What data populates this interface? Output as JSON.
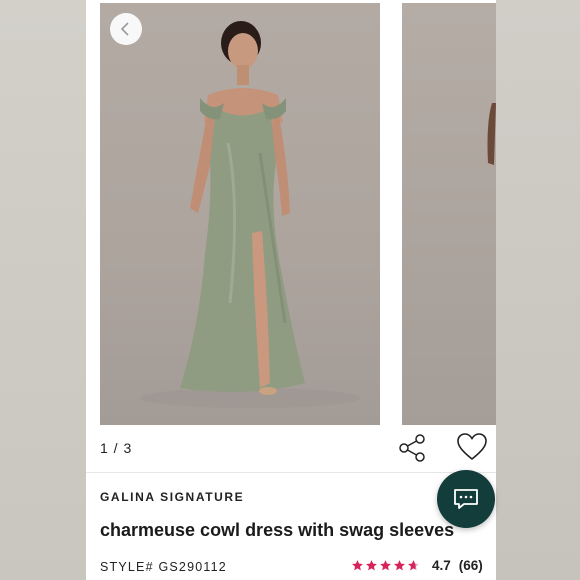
{
  "carousel": {
    "counter": "1 / 3",
    "back_icon": "chevron-left-icon",
    "share_icon": "share-icon",
    "favorite_icon": "heart-icon"
  },
  "product": {
    "brand": "GALINA SIGNATURE",
    "title": "charmeuse cowl dress with swag sleeves",
    "style_label": "STYLE#",
    "style_number": "GS290112",
    "rating": {
      "stars": 4.7,
      "value": "4.7",
      "count": "(66)"
    }
  },
  "chat": {
    "icon": "chat-bubble-icon"
  },
  "colors": {
    "star": "#d6245b",
    "chat_bg": "#123d3a",
    "dress": "#8f9c82"
  }
}
